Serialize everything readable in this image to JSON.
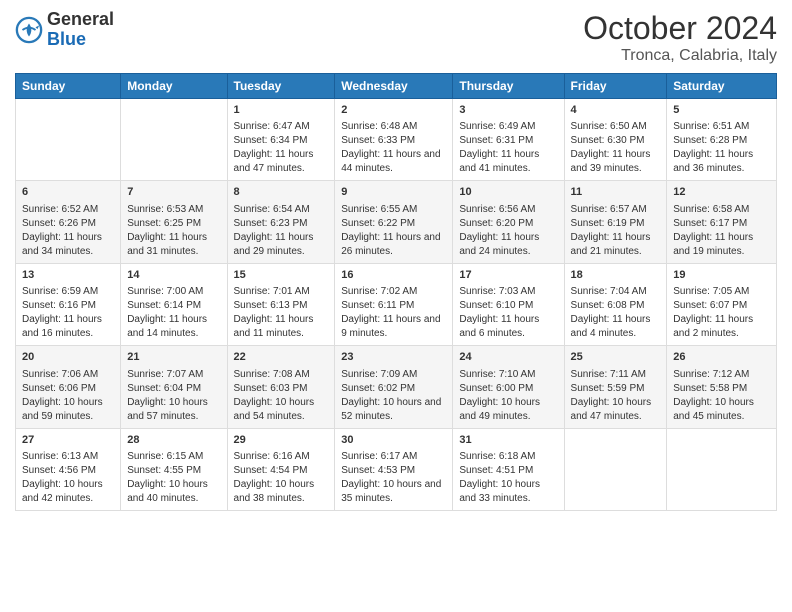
{
  "logo": {
    "general": "General",
    "blue": "Blue"
  },
  "title": "October 2024",
  "subtitle": "Tronca, Calabria, Italy",
  "days_header": [
    "Sunday",
    "Monday",
    "Tuesday",
    "Wednesday",
    "Thursday",
    "Friday",
    "Saturday"
  ],
  "weeks": [
    [
      {
        "day": "",
        "info": ""
      },
      {
        "day": "",
        "info": ""
      },
      {
        "day": "1",
        "info": "Sunrise: 6:47 AM\nSunset: 6:34 PM\nDaylight: 11 hours and 47 minutes."
      },
      {
        "day": "2",
        "info": "Sunrise: 6:48 AM\nSunset: 6:33 PM\nDaylight: 11 hours and 44 minutes."
      },
      {
        "day": "3",
        "info": "Sunrise: 6:49 AM\nSunset: 6:31 PM\nDaylight: 11 hours and 41 minutes."
      },
      {
        "day": "4",
        "info": "Sunrise: 6:50 AM\nSunset: 6:30 PM\nDaylight: 11 hours and 39 minutes."
      },
      {
        "day": "5",
        "info": "Sunrise: 6:51 AM\nSunset: 6:28 PM\nDaylight: 11 hours and 36 minutes."
      }
    ],
    [
      {
        "day": "6",
        "info": "Sunrise: 6:52 AM\nSunset: 6:26 PM\nDaylight: 11 hours and 34 minutes."
      },
      {
        "day": "7",
        "info": "Sunrise: 6:53 AM\nSunset: 6:25 PM\nDaylight: 11 hours and 31 minutes."
      },
      {
        "day": "8",
        "info": "Sunrise: 6:54 AM\nSunset: 6:23 PM\nDaylight: 11 hours and 29 minutes."
      },
      {
        "day": "9",
        "info": "Sunrise: 6:55 AM\nSunset: 6:22 PM\nDaylight: 11 hours and 26 minutes."
      },
      {
        "day": "10",
        "info": "Sunrise: 6:56 AM\nSunset: 6:20 PM\nDaylight: 11 hours and 24 minutes."
      },
      {
        "day": "11",
        "info": "Sunrise: 6:57 AM\nSunset: 6:19 PM\nDaylight: 11 hours and 21 minutes."
      },
      {
        "day": "12",
        "info": "Sunrise: 6:58 AM\nSunset: 6:17 PM\nDaylight: 11 hours and 19 minutes."
      }
    ],
    [
      {
        "day": "13",
        "info": "Sunrise: 6:59 AM\nSunset: 6:16 PM\nDaylight: 11 hours and 16 minutes."
      },
      {
        "day": "14",
        "info": "Sunrise: 7:00 AM\nSunset: 6:14 PM\nDaylight: 11 hours and 14 minutes."
      },
      {
        "day": "15",
        "info": "Sunrise: 7:01 AM\nSunset: 6:13 PM\nDaylight: 11 hours and 11 minutes."
      },
      {
        "day": "16",
        "info": "Sunrise: 7:02 AM\nSunset: 6:11 PM\nDaylight: 11 hours and 9 minutes."
      },
      {
        "day": "17",
        "info": "Sunrise: 7:03 AM\nSunset: 6:10 PM\nDaylight: 11 hours and 6 minutes."
      },
      {
        "day": "18",
        "info": "Sunrise: 7:04 AM\nSunset: 6:08 PM\nDaylight: 11 hours and 4 minutes."
      },
      {
        "day": "19",
        "info": "Sunrise: 7:05 AM\nSunset: 6:07 PM\nDaylight: 11 hours and 2 minutes."
      }
    ],
    [
      {
        "day": "20",
        "info": "Sunrise: 7:06 AM\nSunset: 6:06 PM\nDaylight: 10 hours and 59 minutes."
      },
      {
        "day": "21",
        "info": "Sunrise: 7:07 AM\nSunset: 6:04 PM\nDaylight: 10 hours and 57 minutes."
      },
      {
        "day": "22",
        "info": "Sunrise: 7:08 AM\nSunset: 6:03 PM\nDaylight: 10 hours and 54 minutes."
      },
      {
        "day": "23",
        "info": "Sunrise: 7:09 AM\nSunset: 6:02 PM\nDaylight: 10 hours and 52 minutes."
      },
      {
        "day": "24",
        "info": "Sunrise: 7:10 AM\nSunset: 6:00 PM\nDaylight: 10 hours and 49 minutes."
      },
      {
        "day": "25",
        "info": "Sunrise: 7:11 AM\nSunset: 5:59 PM\nDaylight: 10 hours and 47 minutes."
      },
      {
        "day": "26",
        "info": "Sunrise: 7:12 AM\nSunset: 5:58 PM\nDaylight: 10 hours and 45 minutes."
      }
    ],
    [
      {
        "day": "27",
        "info": "Sunrise: 6:13 AM\nSunset: 4:56 PM\nDaylight: 10 hours and 42 minutes."
      },
      {
        "day": "28",
        "info": "Sunrise: 6:15 AM\nSunset: 4:55 PM\nDaylight: 10 hours and 40 minutes."
      },
      {
        "day": "29",
        "info": "Sunrise: 6:16 AM\nSunset: 4:54 PM\nDaylight: 10 hours and 38 minutes."
      },
      {
        "day": "30",
        "info": "Sunrise: 6:17 AM\nSunset: 4:53 PM\nDaylight: 10 hours and 35 minutes."
      },
      {
        "day": "31",
        "info": "Sunrise: 6:18 AM\nSunset: 4:51 PM\nDaylight: 10 hours and 33 minutes."
      },
      {
        "day": "",
        "info": ""
      },
      {
        "day": "",
        "info": ""
      }
    ]
  ]
}
